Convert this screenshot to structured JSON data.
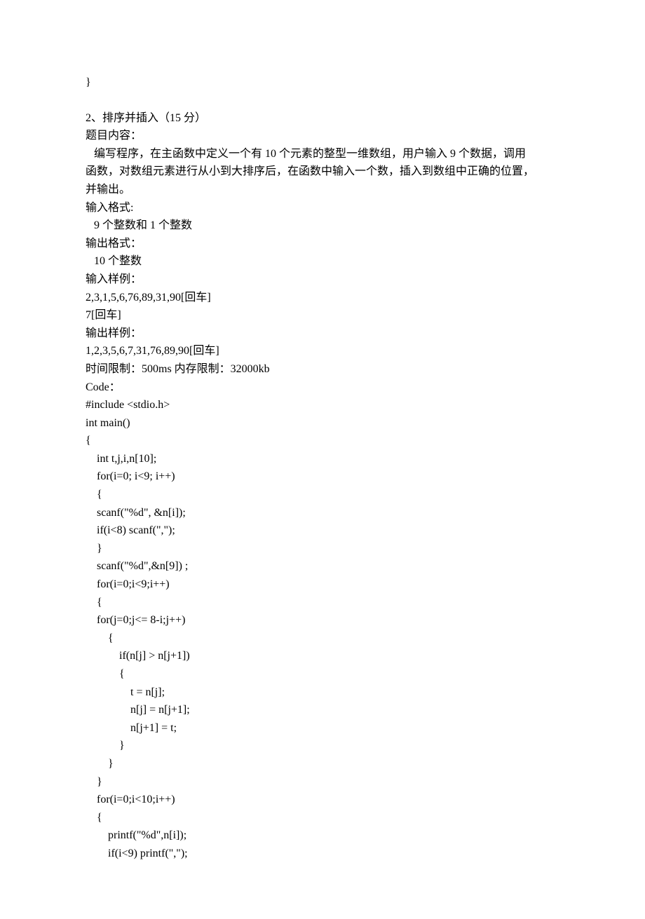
{
  "lines": [
    "}",
    "",
    "2、排序并插入（15 分）",
    "题目内容：",
    "   编写程序，在主函数中定义一个有 10 个元素的整型一维数组，用户输入 9 个数据，调用",
    "函数，对数组元素进行从小到大排序后，在函数中输入一个数，插入到数组中正确的位置，",
    "并输出。",
    "输入格式:",
    "   9 个整数和 1 个整数",
    "输出格式：",
    "   10 个整数",
    "输入样例：",
    "2,3,1,5,6,76,89,31,90[回车]",
    "7[回车]",
    "输出样例：",
    "1,2,3,5,6,7,31,76,89,90[回车]",
    "时间限制：500ms 内存限制：32000kb",
    "Code：",
    "#include <stdio.h>",
    "int main()",
    "{",
    "    int t,j,i,n[10];",
    "    for(i=0; i<9; i++)",
    "    {",
    "    scanf(\"%d\", &n[i]);",
    "    if(i<8) scanf(\",\");",
    "    }",
    "    scanf(\"%d\",&n[9]) ;",
    "    for(i=0;i<9;i++)",
    "    {",
    "    for(j=0;j<= 8-i;j++)",
    "        {",
    "            if(n[j] > n[j+1])",
    "            {",
    "                t = n[j];",
    "                n[j] = n[j+1];",
    "                n[j+1] = t;",
    "            }",
    "        }",
    "    }",
    "    for(i=0;i<10;i++)",
    "    {",
    "        printf(\"%d\",n[i]);",
    "        if(i<9) printf(\",\");"
  ]
}
